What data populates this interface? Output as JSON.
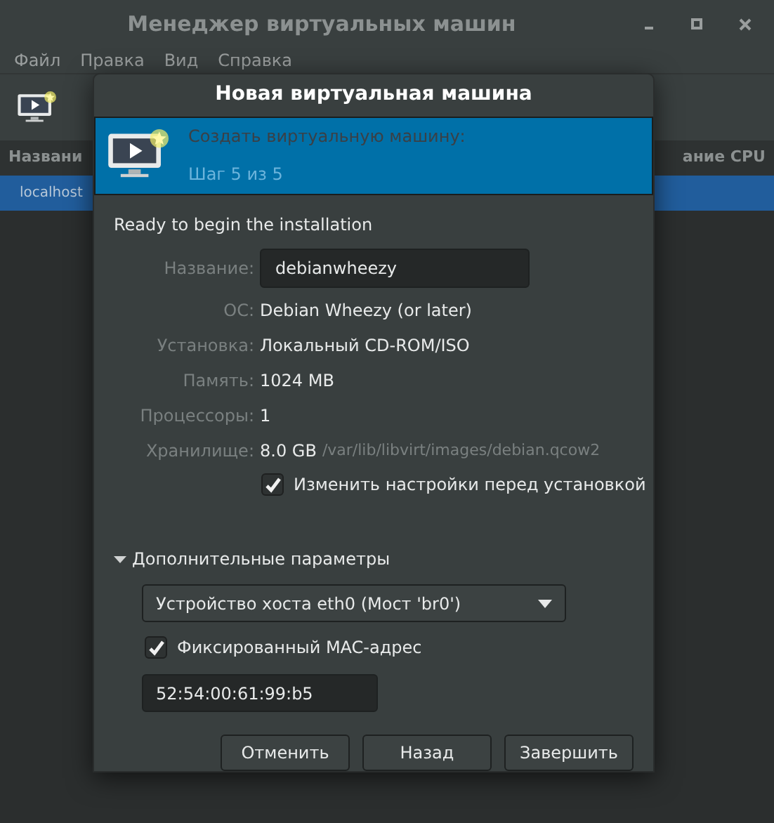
{
  "window": {
    "title": "Менеджер виртуальных машин"
  },
  "menu": [
    "Файл",
    "Правка",
    "Вид",
    "Справка"
  ],
  "table": {
    "columns": [
      "Названи",
      "ание CPU"
    ],
    "rows": [
      {
        "name": "localhost",
        "selected": true
      }
    ]
  },
  "dialog": {
    "title": "Новая виртуальная машина",
    "banner": {
      "heading": "Создать виртуальную машину:",
      "step": "Шаг 5 из 5"
    },
    "intro": "Ready to begin the installation",
    "name_field": {
      "label": "Название:",
      "value": "debianwheezy"
    },
    "details": [
      {
        "label": "ОС:",
        "value": "Debian Wheezy (or later)"
      },
      {
        "label": "Установка:",
        "value": "Локальный CD-ROM/ISO"
      },
      {
        "label": "Память:",
        "value": "1024 MB"
      },
      {
        "label": "Процессоры:",
        "value": "1"
      },
      {
        "label": "Хранилище:",
        "value": "8.0 GB",
        "extra": "/var/lib/libvirt/images/debian.qcow2"
      }
    ],
    "customize": {
      "label": "Изменить настройки перед установкой",
      "checked": true
    },
    "advanced": {
      "label": "Дополнительные параметры",
      "expanded": true,
      "network": "Устройство хоста eth0 (Мост 'br0')",
      "fixed_mac": {
        "label": "Фиксированный MAC-адрес",
        "checked": true
      },
      "mac": "52:54:00:61:99:b5"
    },
    "buttons": [
      "Отменить",
      "Назад",
      "Завершить"
    ]
  }
}
